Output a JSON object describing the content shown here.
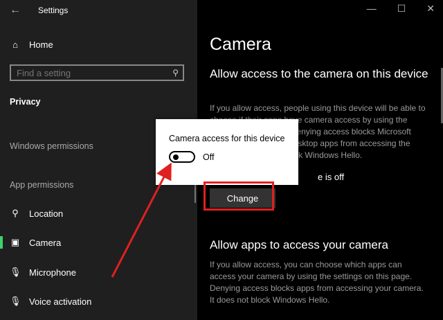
{
  "sidebar": {
    "app_title": "Settings",
    "home_label": "Home",
    "search_placeholder": "Find a setting",
    "privacy_label": "Privacy",
    "windows_permissions": "Windows permissions",
    "app_permissions": "App permissions",
    "items": [
      {
        "label": "Location",
        "icon": "location-icon"
      },
      {
        "label": "Camera",
        "icon": "camera-icon"
      },
      {
        "label": "Microphone",
        "icon": "microphone-icon"
      },
      {
        "label": "Voice activation",
        "icon": "voice-activation-icon"
      }
    ],
    "active_item": "Camera",
    "accent_color": "#3cd36b"
  },
  "main": {
    "title": "Camera",
    "heading": "Allow access to the camera on this device",
    "paragraph": "If you allow access, people using this device will be able to choose if their apps have camera access by using the settings on this page. Denying access blocks Microsoft Store apps and most desktop apps from accessing the camera. It does not block Windows Hello.",
    "status": "e is off",
    "change_label": "Change",
    "heading2": "Allow apps to access your camera",
    "paragraph2": "If you allow access, you can choose which apps can access your camera by using the settings on this page. Denying access blocks apps from accessing your camera. It does not block Windows Hello."
  },
  "popup": {
    "title": "Camera access for this device",
    "toggle_state": "Off"
  },
  "annotation_color": "#e02020"
}
